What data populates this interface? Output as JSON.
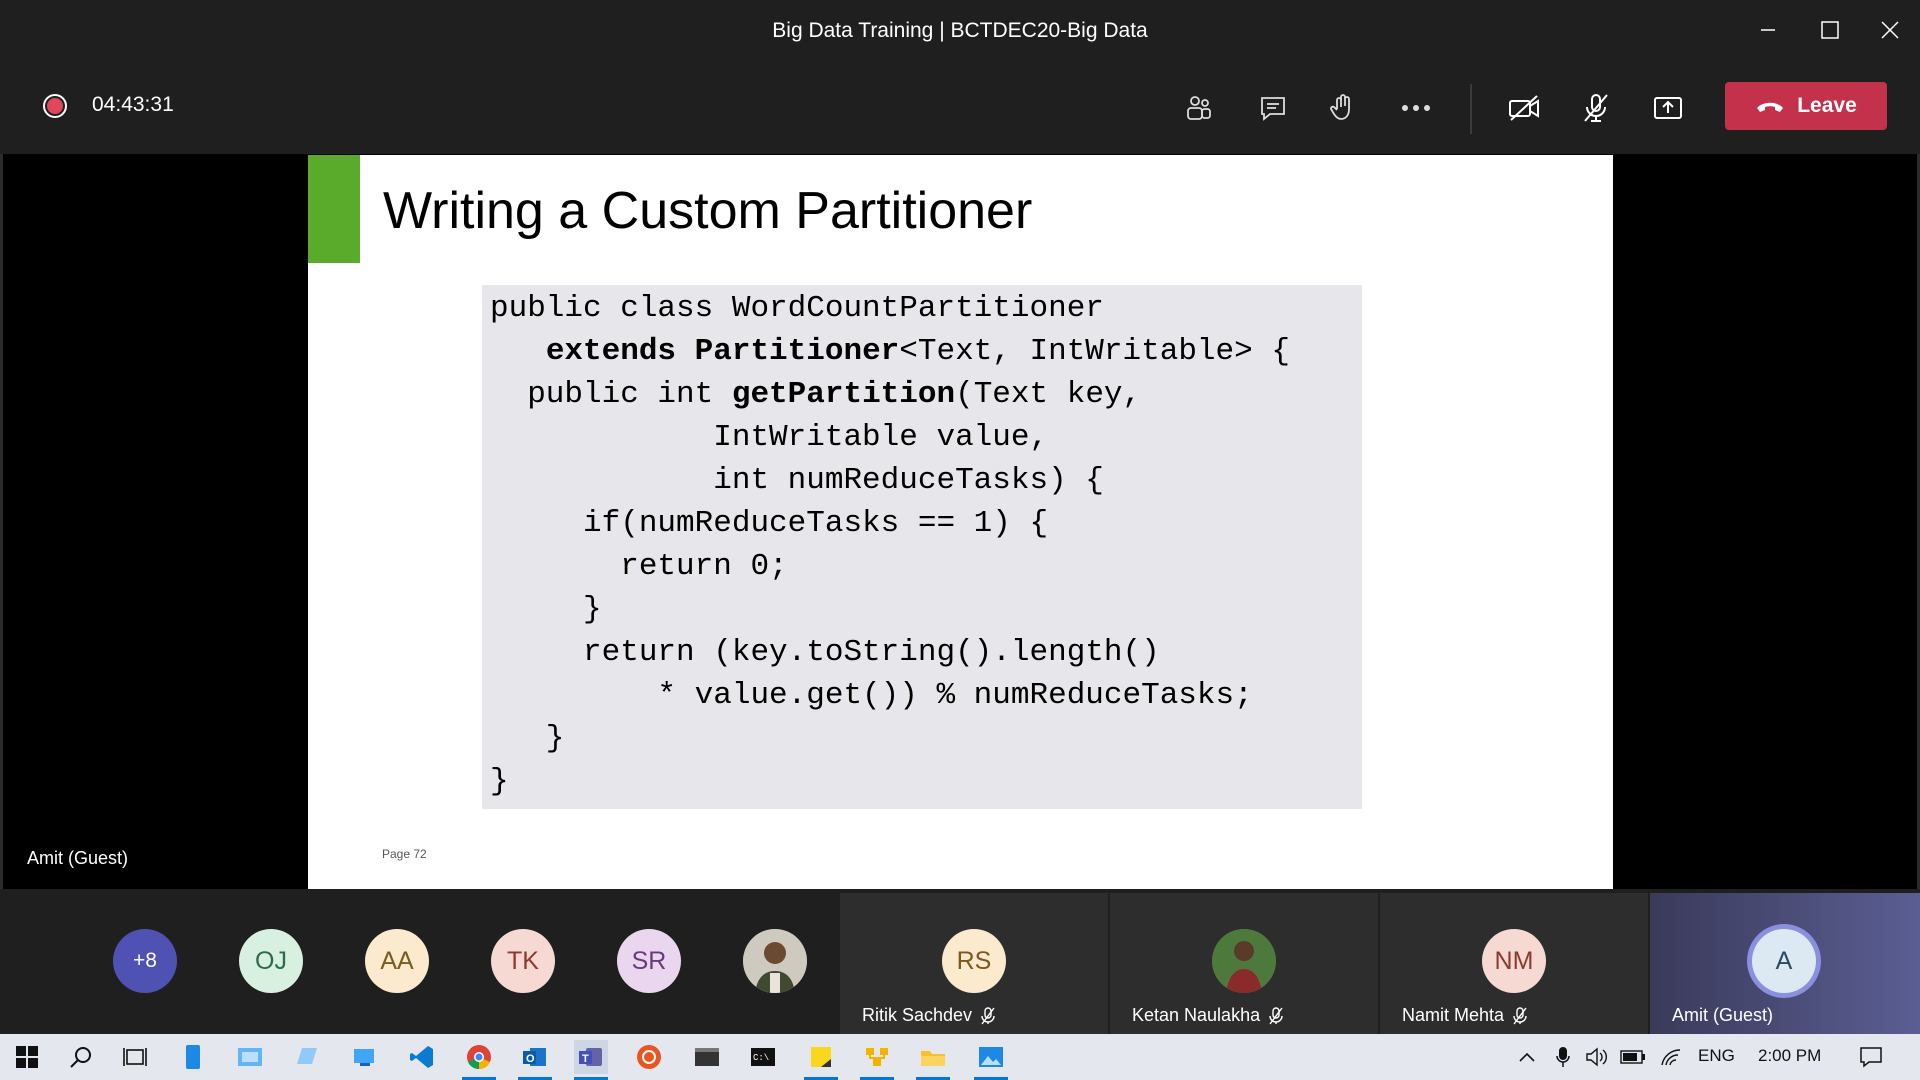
{
  "window": {
    "title": "Big Data Training | BCTDEC20-Big Data"
  },
  "meeting_bar": {
    "elapsed": "04:43:31",
    "leave_label": "Leave"
  },
  "slide": {
    "title": "Writing a Custom Partitioner",
    "code_lines": [
      {
        "pre": "public class WordCountPartitioner",
        "bold": "",
        "post": ""
      },
      {
        "pre": "   ",
        "bold": "extends Partitioner",
        "post": "<Text, IntWritable> {"
      },
      {
        "pre": "  public int ",
        "bold": "getPartition",
        "post": "(Text key,"
      },
      {
        "pre": "            IntWritable value,",
        "bold": "",
        "post": ""
      },
      {
        "pre": "            int numReduceTasks) {",
        "bold": "",
        "post": ""
      },
      {
        "pre": "     if(numReduceTasks == 1) {",
        "bold": "",
        "post": ""
      },
      {
        "pre": "       return 0;",
        "bold": "",
        "post": ""
      },
      {
        "pre": "     }",
        "bold": "",
        "post": ""
      },
      {
        "pre": "     return (key.toString().length()",
        "bold": "",
        "post": ""
      },
      {
        "pre": "         * value.get()) % numReduceTasks;",
        "bold": "",
        "post": ""
      },
      {
        "pre": "   }",
        "bold": "",
        "post": ""
      },
      {
        "pre": "}",
        "bold": "",
        "post": ""
      }
    ],
    "page_label": "Page 72"
  },
  "stage": {
    "speaker_name": "Amit (Guest)"
  },
  "participants": {
    "overflow": "+8",
    "avatars": [
      {
        "initials": "OJ",
        "bg": "#d7f0e0",
        "fg": "#2e6b4a"
      },
      {
        "initials": "AA",
        "bg": "#fbeacd",
        "fg": "#7a5a1f"
      },
      {
        "initials": "TK",
        "bg": "#f7d9d3",
        "fg": "#8b3a2f"
      },
      {
        "initials": "SR",
        "bg": "#ead7ef",
        "fg": "#6a3b7a"
      }
    ],
    "tiles": [
      {
        "initials": "RS",
        "name": "Ritik Sachdev",
        "bg": "#fbeacd",
        "fg": "#7a5a1f"
      },
      {
        "initials": "",
        "name": "Ketan Naulakha",
        "bg": "#4a6b3a",
        "fg": "#fff"
      },
      {
        "initials": "NM",
        "name": "Namit Mehta",
        "bg": "#f7d9d3",
        "fg": "#8b3a2f"
      },
      {
        "initials": "A",
        "name": "Amit (Guest)",
        "bg": "#dde9f2",
        "fg": "#2a4a63"
      }
    ]
  },
  "taskbar": {
    "language": "ENG",
    "time": "2:00 PM"
  },
  "colors": {
    "leave": "#c4314b",
    "slide_accent": "#5aab2c",
    "recording": "#e0475b"
  }
}
